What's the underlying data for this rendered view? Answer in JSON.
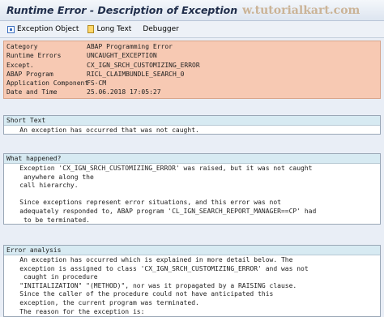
{
  "window": {
    "title": "Runtime Error - Description of Exception",
    "watermark": "w.tutorialkart.com"
  },
  "toolbar": {
    "exception_object": "Exception Object",
    "long_text": "Long Text",
    "debugger": "Debugger"
  },
  "header": {
    "rows": [
      {
        "label": "Category",
        "value": "ABAP Programming Error"
      },
      {
        "label": "Runtime Errors",
        "value": "UNCAUGHT_EXCEPTION"
      },
      {
        "label": "Except.",
        "value": "CX_IGN_SRCH_CUSTOMIZING_ERROR"
      },
      {
        "label": "ABAP Program",
        "value": "RICL_CLAIMBUNDLE_SEARCH_0"
      },
      {
        "label": "Application Component",
        "value": "FS-CM"
      },
      {
        "label": "Date and Time",
        "value": "25.06.2018 17:05:27"
      }
    ]
  },
  "sections": {
    "short_text": {
      "heading": "Short Text",
      "lines": [
        "    An exception has occurred that was not caught."
      ]
    },
    "what_happened": {
      "heading": "What happened?",
      "lines": [
        "    Exception 'CX_IGN_SRCH_CUSTOMIZING_ERROR' was raised, but it was not caught",
        "     anywhere along the",
        "    call hierarchy.",
        "",
        "    Since exceptions represent error situations, and this error was not",
        "    adequately responded to, ABAP program 'CL_IGN_SEARCH_REPORT_MANAGER==CP' had",
        "     to be terminated."
      ]
    },
    "error_analysis": {
      "heading": "Error analysis",
      "lines": [
        "    An exception has occurred which is explained in more detail below. The",
        "    exception is assigned to class 'CX_IGN_SRCH_CUSTOMIZING_ERROR' and was not",
        "     caught in procedure",
        "    \"INITIALIZATION\" \"(METHOD)\", nor was it propagated by a RAISING clause.",
        "    Since the caller of the procedure could not have anticipated this",
        "    exception, the current program was terminated.",
        "    The reason for the exception is:"
      ]
    }
  },
  "colors": {
    "header_panel": "#f7c9b3",
    "section_heading": "#d7eaf2",
    "background": "#e9eef6"
  }
}
